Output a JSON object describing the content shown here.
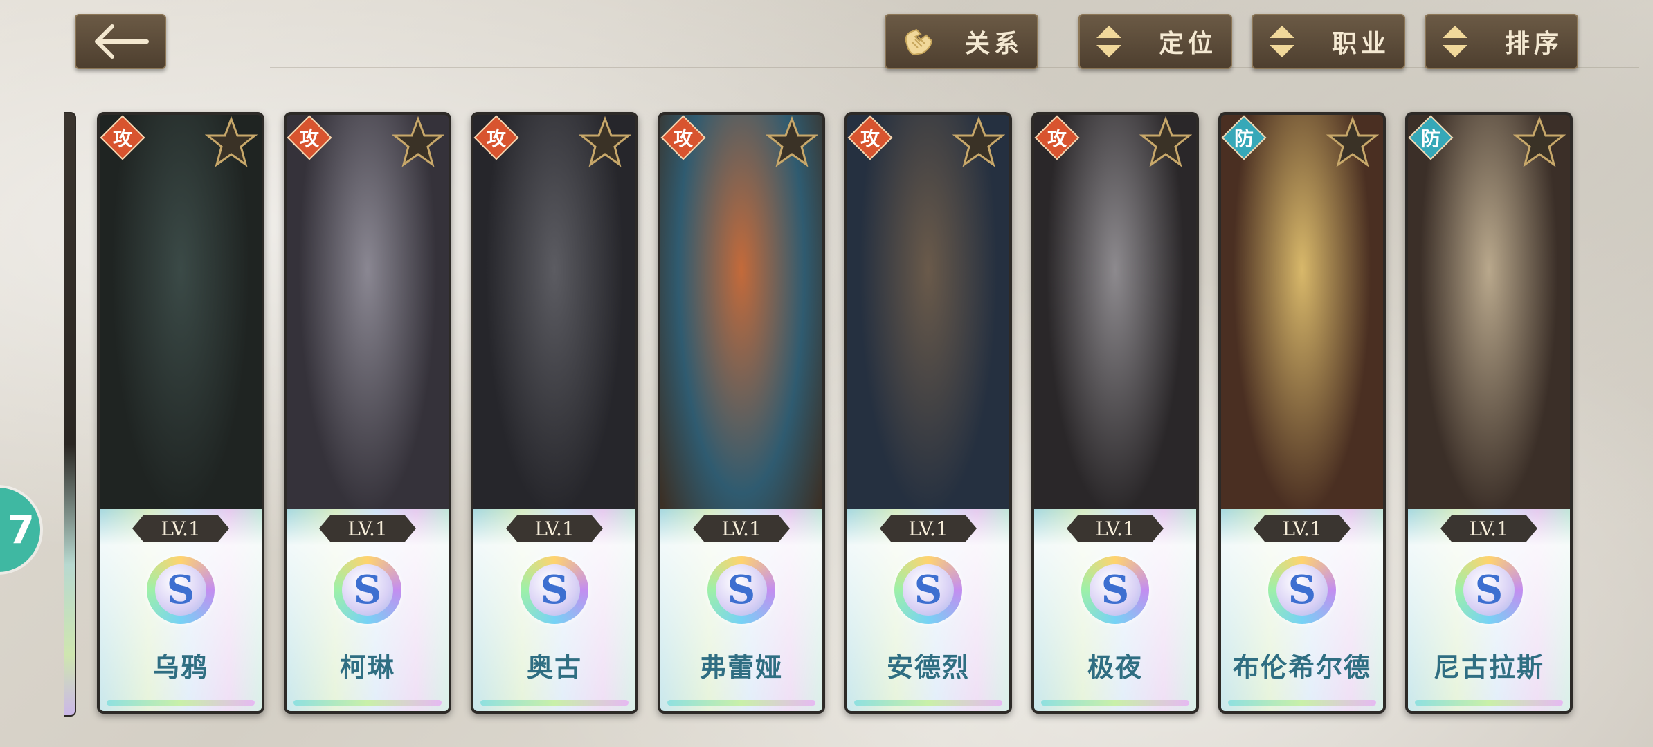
{
  "toolbar": {
    "back_icon": "back-arrow-icon",
    "buttons": [
      {
        "label": "关系",
        "icon": "handshake-icon"
      },
      {
        "label": "定位",
        "icon": "sort-arrows-icon"
      },
      {
        "label": "职业",
        "icon": "sort-arrows-icon"
      },
      {
        "label": "排序",
        "icon": "sort-arrows-icon"
      }
    ]
  },
  "side_badge": {
    "text": "7"
  },
  "colors": {
    "attack": "#d8542f",
    "defense": "#36a8b8",
    "button": "#5a4a38"
  },
  "heroes": [
    {
      "name": "乌鸦",
      "type": "攻",
      "level": "LV.1",
      "rank": "S"
    },
    {
      "name": "柯琳",
      "type": "攻",
      "level": "LV.1",
      "rank": "S"
    },
    {
      "name": "奥古",
      "type": "攻",
      "level": "LV.1",
      "rank": "S"
    },
    {
      "name": "弗蕾娅",
      "type": "攻",
      "level": "LV.1",
      "rank": "S"
    },
    {
      "name": "安德烈",
      "type": "攻",
      "level": "LV.1",
      "rank": "S"
    },
    {
      "name": "极夜",
      "type": "攻",
      "level": "LV.1",
      "rank": "S"
    },
    {
      "name": "布伦希尔德",
      "type": "防",
      "level": "LV.1",
      "rank": "S"
    },
    {
      "name": "尼古拉斯",
      "type": "防",
      "level": "LV.1",
      "rank": "S"
    }
  ]
}
